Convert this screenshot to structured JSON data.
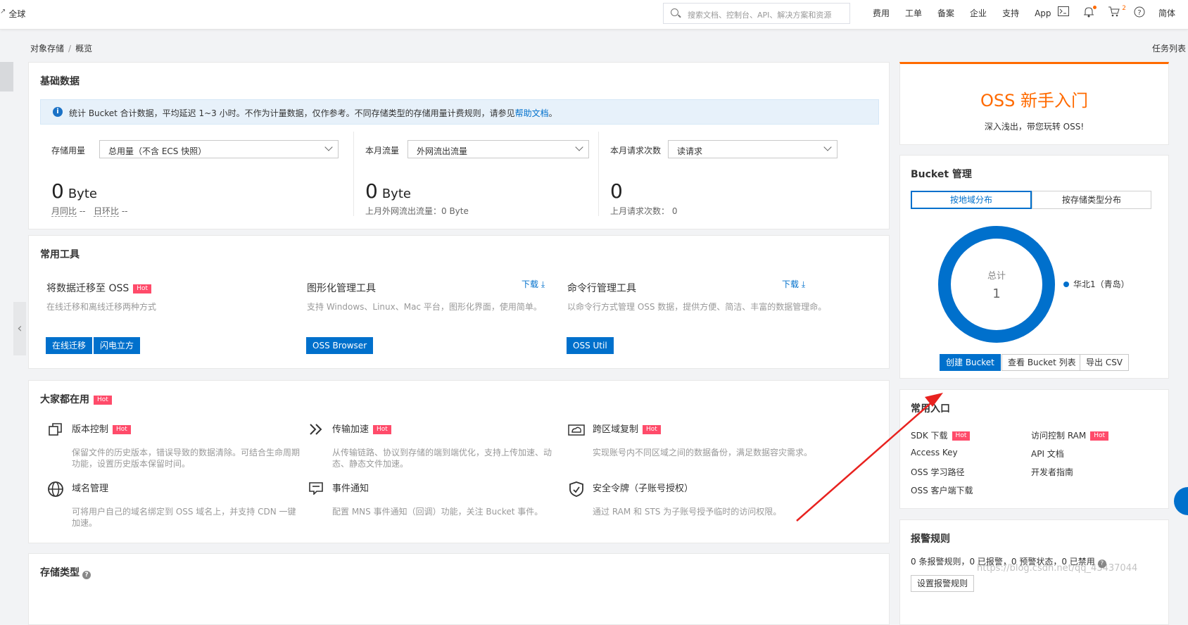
{
  "topbar": {
    "region": "全球",
    "search_placeholder": "搜索文档、控制台、API、解决方案和资源",
    "nav": [
      "费用",
      "工单",
      "备案",
      "企业",
      "支持",
      "App"
    ],
    "cart_count": "2",
    "lang": "简体"
  },
  "breadcrumb": {
    "root": "对象存储",
    "sep": "/",
    "current": "概览"
  },
  "task_list": "任务列表",
  "basic": {
    "title": "基础数据",
    "notice_text": "统计 Bucket 合计数据，平均延迟 1~3 小时。不作为计量数据，仅作参考。不同存储类型的存储用量计费规则，请参见",
    "notice_link": "帮助文档",
    "notice_end": "。",
    "storage": {
      "label": "存储用量",
      "select": "总用量（不含 ECS 快照）",
      "value": "0",
      "unit": "Byte",
      "mom_label": "月同比",
      "mom_val": "--",
      "dod_label": "日环比",
      "dod_val": "--"
    },
    "traffic": {
      "label": "本月流量",
      "select": "外网流出流量",
      "value": "0",
      "unit": "Byte",
      "sub": "上月外网流出流量：0 Byte"
    },
    "requests": {
      "label": "本月请求次数",
      "select": "读请求",
      "value": "0",
      "sub": "上月请求次数：",
      "sub_val": "0"
    }
  },
  "tools": {
    "title": "常用工具",
    "hot": "Hot",
    "download": "下载",
    "migrate": {
      "title": "将数据迁移至 OSS",
      "desc": "在线迁移和离线迁移两种方式",
      "btn1": "在线迁移",
      "btn2": "闪电立方"
    },
    "gui": {
      "title": "图形化管理工具",
      "desc": "支持 Windows、Linux、Mac 平台，图形化界面，使用简单。",
      "btn": "OSS Browser"
    },
    "cli": {
      "title": "命令行管理工具",
      "desc": "以命令行方式管理 OSS 数据，提供方便、简洁、丰富的数据管理命。",
      "btn": "OSS Util"
    }
  },
  "popular": {
    "title": "大家都在用",
    "hot": "Hot",
    "items": [
      {
        "title": "版本控制",
        "hot": true,
        "desc": "保留文件的历史版本，错误导致的数据清除。可结合生命周期功能，设置历史版本保留时间。"
      },
      {
        "title": "传输加速",
        "hot": true,
        "desc": "从传输链路、协议到存储的端到端优化，支持上传加速、动态、静态文件加速。"
      },
      {
        "title": "跨区域复制",
        "hot": true,
        "desc": "实现账号内不同区域之间的数据备份，满足数据容灾需求。"
      },
      {
        "title": "域名管理",
        "hot": false,
        "desc": "可将用户自己的域名绑定到 OSS 域名上，并支持 CDN 一键加速。"
      },
      {
        "title": "事件通知",
        "hot": false,
        "desc": "配置 MNS 事件通知（回调）功能，关注 Bucket 事件。"
      },
      {
        "title": "安全令牌（子账号授权）",
        "hot": false,
        "desc": "通过 RAM 和 STS 为子账号授予临时的访问权限。"
      }
    ]
  },
  "storage_types": {
    "title": "存储类型"
  },
  "intro": {
    "title": "OSS 新手入门",
    "subtitle": "深入浅出，带您玩转 OSS!"
  },
  "bucket": {
    "title": "Bucket 管理",
    "tab_region": "按地域分布",
    "tab_type": "按存储类型分布",
    "total_label": "总计",
    "total_value": "1",
    "legend": "华北1（青岛）",
    "create": "创建 Bucket",
    "list": "查看 Bucket 列表",
    "export": "导出 CSV"
  },
  "chart_data": {
    "type": "pie",
    "categories": [
      "华北1（青岛）"
    ],
    "values": [
      1
    ]
  },
  "entries": {
    "title": "常用入口",
    "hot": "Hot",
    "sdk": "SDK 下载",
    "ram": "访问控制 RAM",
    "accesskey": "Access Key",
    "api": "API 文档",
    "learning": "OSS 学习路径",
    "devguide": "开发者指南",
    "client": "OSS 客户端下载"
  },
  "alarm": {
    "title": "报警规则",
    "text": "0 条报警规则，0 已报警，0 预警状态，0 已禁用",
    "btn": "设置报警规则"
  },
  "watermark": "https://blog.csdn.net/qq_43437044",
  "colors": {
    "primary": "#0070cc",
    "accent": "#ff6a00",
    "hot": "#ff4b6a"
  }
}
